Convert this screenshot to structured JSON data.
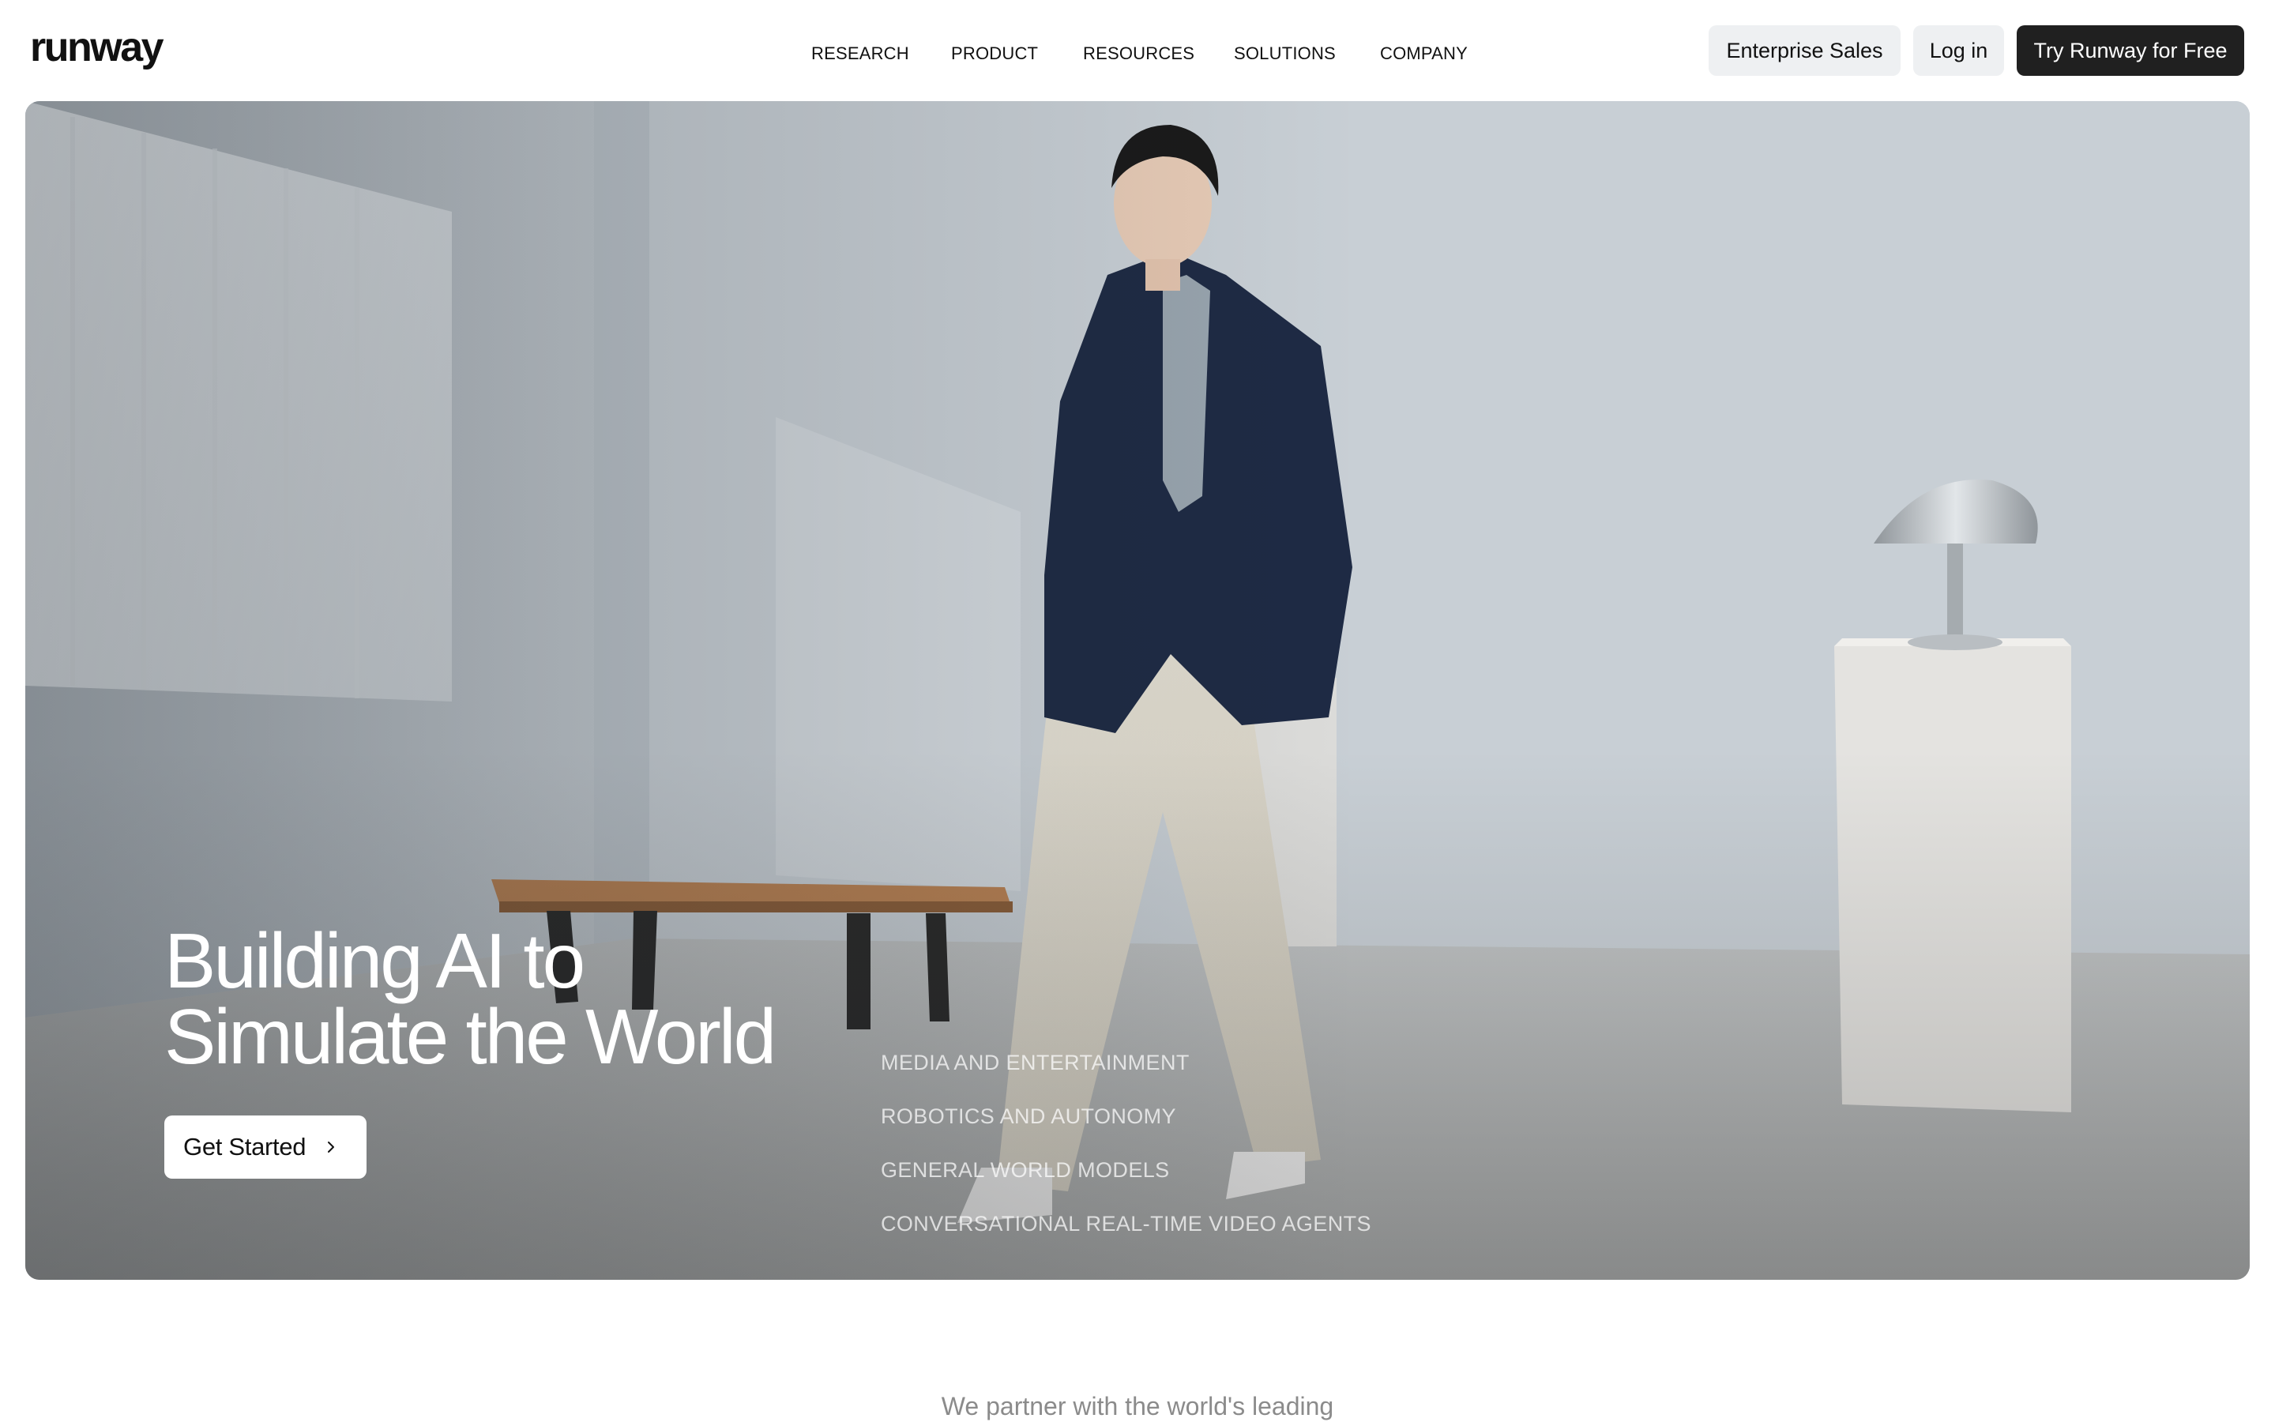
{
  "header": {
    "logo": "runway",
    "nav": [
      "RESEARCH",
      "PRODUCT",
      "RESOURCES",
      "SOLUTIONS",
      "COMPANY"
    ],
    "enterprise_label": "Enterprise Sales",
    "login_label": "Log in",
    "try_label": "Try Runway for Free"
  },
  "hero": {
    "title_line1": "Building AI to",
    "title_line2": "Simulate the World",
    "cta_label": "Get Started",
    "cta_icon": "chevron-right-icon",
    "topics": [
      "MEDIA AND ENTERTAINMENT",
      "ROBOTICS AND AUTONOMY",
      "GENERAL WORLD MODELS",
      "CONVERSATIONAL REAL-TIME VIDEO AGENTS"
    ]
  },
  "partners": {
    "intro": "We partner with the world's leading"
  },
  "colors": {
    "primary_button": "#202020",
    "secondary_button": "#eef0f2",
    "text": "#111111",
    "muted_text": "#8b8b8b"
  }
}
